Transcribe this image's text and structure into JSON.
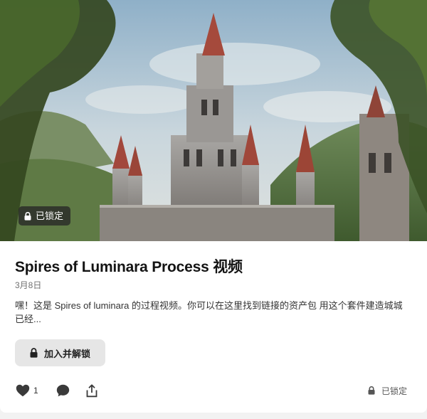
{
  "post": {
    "title": "Spires of Luminara Process 视频",
    "date": "3月8日",
    "description": "嘿！这是 Spires of luminara 的过程视频。你可以在这里找到链接的资产包 用这个套件建造城城已经...",
    "lock_badge": "已锁定",
    "unlock_button": "加入并解锁",
    "like_count": "1",
    "locked_status": "已锁定"
  },
  "icons": {
    "lock": "lock-icon",
    "heart": "heart-icon",
    "comment": "comment-icon",
    "share": "share-icon"
  },
  "colors": {
    "button_bg": "#e6e6e6",
    "badge_bg": "#262626",
    "icon": "#3a3a3a"
  }
}
